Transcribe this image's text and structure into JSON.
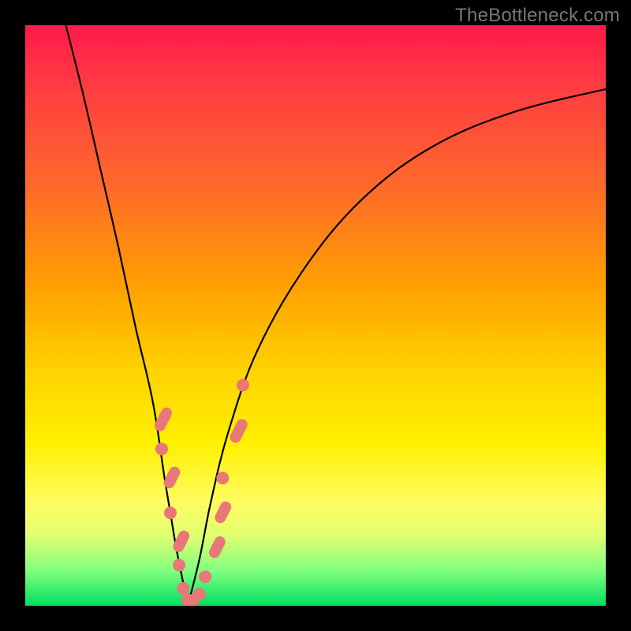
{
  "watermark": "TheBottleneck.com",
  "chart_data": {
    "type": "line",
    "title": "",
    "xlabel": "",
    "ylabel": "",
    "xlim": [
      0,
      100
    ],
    "ylim": [
      0,
      100
    ],
    "series": [
      {
        "name": "left-curve",
        "x": [
          7,
          10,
          13,
          16,
          19,
          22,
          24,
          25,
          26,
          27,
          28
        ],
        "y": [
          100,
          88,
          75,
          62,
          48,
          35,
          22,
          16,
          10,
          5,
          0
        ]
      },
      {
        "name": "right-curve",
        "x": [
          28,
          30,
          32,
          35,
          40,
          48,
          58,
          70,
          84,
          100
        ],
        "y": [
          0,
          8,
          18,
          30,
          44,
          58,
          70,
          79,
          85,
          89
        ]
      }
    ],
    "markers": {
      "name": "data-points",
      "points": [
        {
          "x": 22.5,
          "y": 32,
          "kind": "pill",
          "len": 6
        },
        {
          "x": 23.5,
          "y": 27,
          "kind": "dot"
        },
        {
          "x": 24.2,
          "y": 22,
          "kind": "pill",
          "len": 5
        },
        {
          "x": 25.0,
          "y": 16,
          "kind": "dot"
        },
        {
          "x": 25.8,
          "y": 11,
          "kind": "pill",
          "len": 5
        },
        {
          "x": 26.5,
          "y": 7,
          "kind": "dot"
        },
        {
          "x": 27.2,
          "y": 3,
          "kind": "dot"
        },
        {
          "x": 28.0,
          "y": 1,
          "kind": "dot"
        },
        {
          "x": 29.0,
          "y": 1,
          "kind": "dot"
        },
        {
          "x": 30.0,
          "y": 2,
          "kind": "dot"
        },
        {
          "x": 31.0,
          "y": 5,
          "kind": "dot"
        },
        {
          "x": 32.0,
          "y": 10,
          "kind": "pill",
          "len": 5
        },
        {
          "x": 33.0,
          "y": 16,
          "kind": "pill",
          "len": 5
        },
        {
          "x": 34.0,
          "y": 22,
          "kind": "dot"
        },
        {
          "x": 35.5,
          "y": 30,
          "kind": "pill",
          "len": 6
        },
        {
          "x": 37.5,
          "y": 38,
          "kind": "dot"
        }
      ]
    },
    "gradient_colors": {
      "top": "#ff1a4a",
      "mid": "#ffd400",
      "bottom": "#00e060"
    }
  }
}
